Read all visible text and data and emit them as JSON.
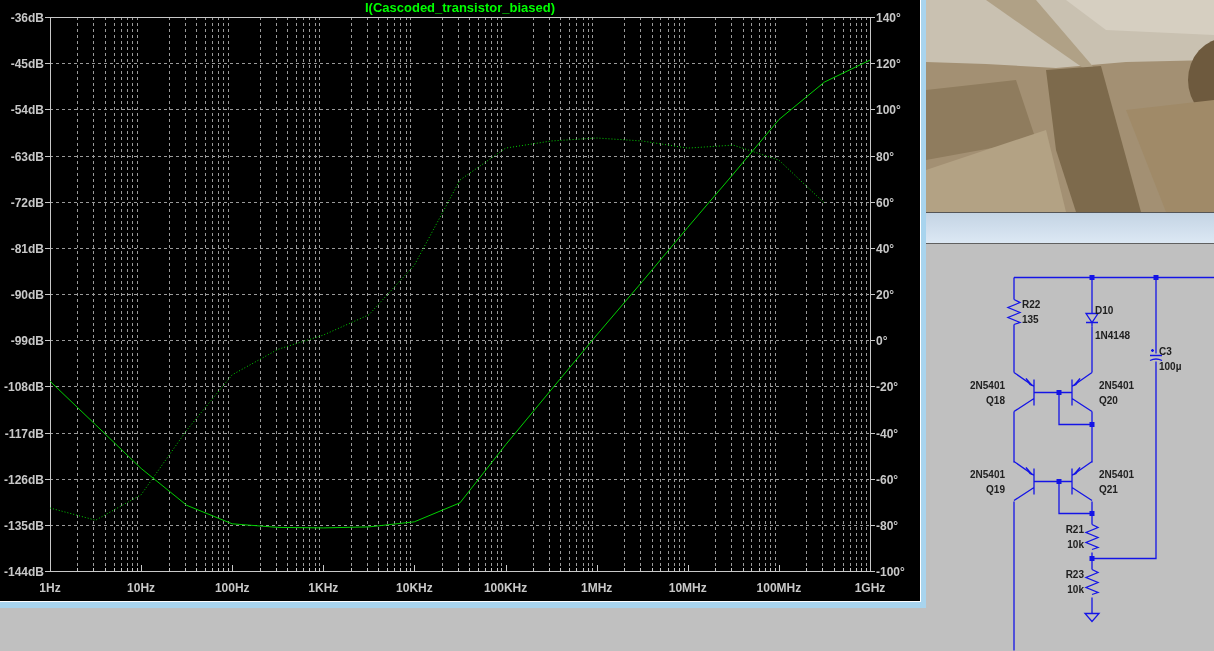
{
  "plot": {
    "chart_data": {
      "type": "line",
      "title": "I(Cascoded_transistor_biased)",
      "ylim": [
        -144,
        -36
      ],
      "y2lim": [
        -100,
        140
      ],
      "grid": true,
      "categories": [
        "1Hz",
        null,
        "10Hz",
        null,
        "100Hz",
        null,
        "1KHz",
        null,
        "10KHz",
        null,
        "100KHz",
        null,
        "1MHz",
        null,
        "10MHz",
        null,
        "100MHz",
        null,
        "1GHz"
      ],
      "yticks": [
        {
          "value": -36,
          "label": "-36dB"
        },
        {
          "value": -45,
          "label": "-45dB"
        },
        {
          "value": -54,
          "label": "-54dB"
        },
        {
          "value": -63,
          "label": "-63dB"
        },
        {
          "value": -72,
          "label": "-72dB"
        },
        {
          "value": -81,
          "label": "-81dB"
        },
        {
          "value": -90,
          "label": "-90dB"
        },
        {
          "value": -99,
          "label": "-99dB"
        },
        {
          "value": -108,
          "label": "-108dB"
        },
        {
          "value": -117,
          "label": "-117dB"
        },
        {
          "value": -126,
          "label": "-126dB"
        },
        {
          "value": -135,
          "label": "-135dB"
        },
        {
          "value": -144,
          "label": "-144dB"
        }
      ],
      "y2ticks": [
        {
          "value": 140,
          "label": "140°"
        },
        {
          "value": 120,
          "label": "120°"
        },
        {
          "value": 100,
          "label": "100°"
        },
        {
          "value": 80,
          "label": "80°"
        },
        {
          "value": 60,
          "label": "60°"
        },
        {
          "value": 40,
          "label": "40°"
        },
        {
          "value": 20,
          "label": "20°"
        },
        {
          "value": 0,
          "label": "0°"
        },
        {
          "value": -20,
          "label": "-20°"
        },
        {
          "value": -40,
          "label": "-40°"
        },
        {
          "value": -60,
          "label": "-60°"
        },
        {
          "value": -80,
          "label": "-80°"
        },
        {
          "value": -100,
          "label": "-100°"
        }
      ],
      "series": [
        {
          "color": "#00d000",
          "values": [
            -107,
            -115.5,
            -124,
            -131.2,
            -134.8,
            -135.5,
            -135.6,
            -135.4,
            -134.4,
            -130.7,
            -119.4,
            -108.7,
            -98,
            -87.6,
            -77,
            -66.6,
            -56,
            -48.7,
            -44.4
          ]
        },
        {
          "axis": "y2",
          "line_style": "dotted",
          "color": "#00d000",
          "values": [
            -72.7,
            -78,
            -67,
            -39,
            -15,
            -4,
            2.2,
            11,
            32.5,
            69.4,
            83.2,
            86.3,
            87.6,
            86.3,
            83.2,
            84.5,
            78,
            59.4,
            null
          ]
        }
      ]
    }
  },
  "schematic": {
    "components": [
      {
        "kind": "resistor",
        "ref": "R22",
        "value": "135"
      },
      {
        "kind": "diode",
        "ref": "D10",
        "value": "1N4148"
      },
      {
        "kind": "capacitor",
        "ref": "C3",
        "value": "100µ"
      },
      {
        "kind": "pnp",
        "ref": "Q18",
        "value": "2N5401"
      },
      {
        "kind": "pnp",
        "ref": "Q20",
        "value": "2N5401"
      },
      {
        "kind": "pnp",
        "ref": "Q19",
        "value": "2N5401"
      },
      {
        "kind": "pnp",
        "ref": "Q21",
        "value": "2N5401"
      },
      {
        "kind": "resistor",
        "ref": "R21",
        "value": "10k"
      },
      {
        "kind": "resistor",
        "ref": "R23",
        "value": "10k"
      }
    ]
  }
}
